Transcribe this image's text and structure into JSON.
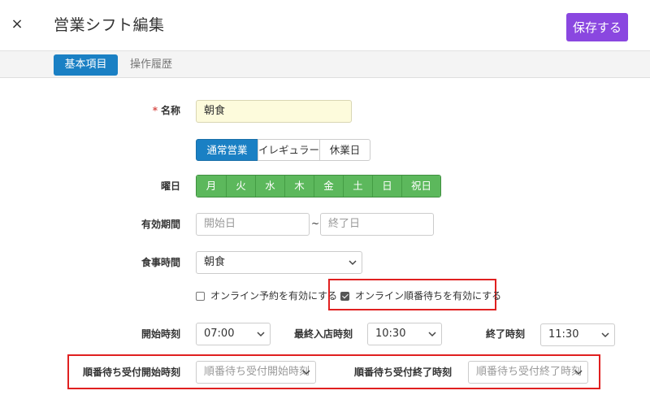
{
  "header": {
    "close_icon": "×",
    "title": "営業シフト編集",
    "save_label": "保存する"
  },
  "tabs": [
    {
      "label": "基本項目",
      "active": true
    },
    {
      "label": "操作履歴",
      "active": false
    }
  ],
  "form": {
    "name": {
      "required_mark": "*",
      "label": "名称",
      "value": "朝食"
    },
    "business_type": {
      "options": [
        "通常営業",
        "イレギュラー",
        "休業日"
      ],
      "selected": "通常営業"
    },
    "weekday": {
      "label": "曜日",
      "days": [
        "月",
        "火",
        "水",
        "木",
        "金",
        "土",
        "日",
        "祝日"
      ]
    },
    "period": {
      "label": "有効期間",
      "start_placeholder": "開始日",
      "separator": "~",
      "end_placeholder": "終了日"
    },
    "meal_time": {
      "label": "食事時間",
      "value": "朝食"
    },
    "online_reservation": {
      "label": "オンライン予約を有効にする",
      "checked": false
    },
    "online_queue": {
      "label": "オンライン順番待ちを有効にする",
      "checked": true
    },
    "start_time": {
      "label": "開始時刻",
      "value": "07:00"
    },
    "last_entry_time": {
      "label": "最終入店時刻",
      "value": "10:30"
    },
    "end_time": {
      "label": "終了時刻",
      "value": "11:30"
    },
    "queue_start": {
      "label": "順番待ち受付開始時刻",
      "placeholder": "順番待ち受付開始時刻"
    },
    "queue_end": {
      "label": "順番待ち受付終了時刻",
      "placeholder": "順番待ち受付終了時刻"
    }
  },
  "colors": {
    "primary_purple": "#8a47e0",
    "tab_blue": "#1a80c4",
    "day_green": "#5cb85c",
    "highlight_red": "#e02020",
    "name_input_bg": "#fdfbdc"
  }
}
